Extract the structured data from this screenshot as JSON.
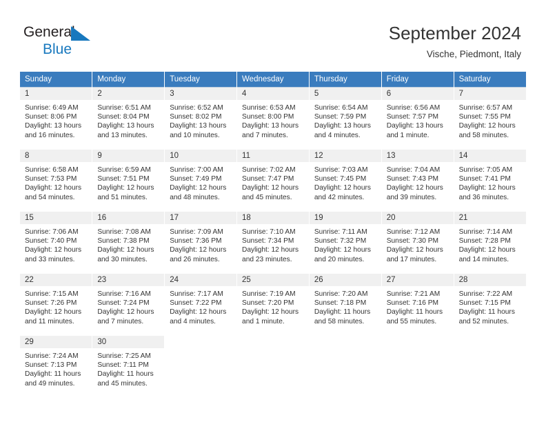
{
  "brand": {
    "name_part1": "General",
    "name_part2": "Blue",
    "flag_icon": "triangle-flag-icon",
    "color_dark": "#231f20",
    "color_blue": "#1878be"
  },
  "header": {
    "title": "September 2024",
    "location": "Vische, Piedmont, Italy"
  },
  "theme": {
    "header_bg": "#3a7cbe",
    "daynum_bg": "#f0f0f0",
    "row_divider": "#b9cbdd",
    "text": "#333333"
  },
  "weekday_headers": [
    "Sunday",
    "Monday",
    "Tuesday",
    "Wednesday",
    "Thursday",
    "Friday",
    "Saturday"
  ],
  "weeks": [
    [
      {
        "day": "1",
        "sunrise": "Sunrise: 6:49 AM",
        "sunset": "Sunset: 8:06 PM",
        "daylight1": "Daylight: 13 hours",
        "daylight2": "and 16 minutes."
      },
      {
        "day": "2",
        "sunrise": "Sunrise: 6:51 AM",
        "sunset": "Sunset: 8:04 PM",
        "daylight1": "Daylight: 13 hours",
        "daylight2": "and 13 minutes."
      },
      {
        "day": "3",
        "sunrise": "Sunrise: 6:52 AM",
        "sunset": "Sunset: 8:02 PM",
        "daylight1": "Daylight: 13 hours",
        "daylight2": "and 10 minutes."
      },
      {
        "day": "4",
        "sunrise": "Sunrise: 6:53 AM",
        "sunset": "Sunset: 8:00 PM",
        "daylight1": "Daylight: 13 hours",
        "daylight2": "and 7 minutes."
      },
      {
        "day": "5",
        "sunrise": "Sunrise: 6:54 AM",
        "sunset": "Sunset: 7:59 PM",
        "daylight1": "Daylight: 13 hours",
        "daylight2": "and 4 minutes."
      },
      {
        "day": "6",
        "sunrise": "Sunrise: 6:56 AM",
        "sunset": "Sunset: 7:57 PM",
        "daylight1": "Daylight: 13 hours",
        "daylight2": "and 1 minute."
      },
      {
        "day": "7",
        "sunrise": "Sunrise: 6:57 AM",
        "sunset": "Sunset: 7:55 PM",
        "daylight1": "Daylight: 12 hours",
        "daylight2": "and 58 minutes."
      }
    ],
    [
      {
        "day": "8",
        "sunrise": "Sunrise: 6:58 AM",
        "sunset": "Sunset: 7:53 PM",
        "daylight1": "Daylight: 12 hours",
        "daylight2": "and 54 minutes."
      },
      {
        "day": "9",
        "sunrise": "Sunrise: 6:59 AM",
        "sunset": "Sunset: 7:51 PM",
        "daylight1": "Daylight: 12 hours",
        "daylight2": "and 51 minutes."
      },
      {
        "day": "10",
        "sunrise": "Sunrise: 7:00 AM",
        "sunset": "Sunset: 7:49 PM",
        "daylight1": "Daylight: 12 hours",
        "daylight2": "and 48 minutes."
      },
      {
        "day": "11",
        "sunrise": "Sunrise: 7:02 AM",
        "sunset": "Sunset: 7:47 PM",
        "daylight1": "Daylight: 12 hours",
        "daylight2": "and 45 minutes."
      },
      {
        "day": "12",
        "sunrise": "Sunrise: 7:03 AM",
        "sunset": "Sunset: 7:45 PM",
        "daylight1": "Daylight: 12 hours",
        "daylight2": "and 42 minutes."
      },
      {
        "day": "13",
        "sunrise": "Sunrise: 7:04 AM",
        "sunset": "Sunset: 7:43 PM",
        "daylight1": "Daylight: 12 hours",
        "daylight2": "and 39 minutes."
      },
      {
        "day": "14",
        "sunrise": "Sunrise: 7:05 AM",
        "sunset": "Sunset: 7:41 PM",
        "daylight1": "Daylight: 12 hours",
        "daylight2": "and 36 minutes."
      }
    ],
    [
      {
        "day": "15",
        "sunrise": "Sunrise: 7:06 AM",
        "sunset": "Sunset: 7:40 PM",
        "daylight1": "Daylight: 12 hours",
        "daylight2": "and 33 minutes."
      },
      {
        "day": "16",
        "sunrise": "Sunrise: 7:08 AM",
        "sunset": "Sunset: 7:38 PM",
        "daylight1": "Daylight: 12 hours",
        "daylight2": "and 30 minutes."
      },
      {
        "day": "17",
        "sunrise": "Sunrise: 7:09 AM",
        "sunset": "Sunset: 7:36 PM",
        "daylight1": "Daylight: 12 hours",
        "daylight2": "and 26 minutes."
      },
      {
        "day": "18",
        "sunrise": "Sunrise: 7:10 AM",
        "sunset": "Sunset: 7:34 PM",
        "daylight1": "Daylight: 12 hours",
        "daylight2": "and 23 minutes."
      },
      {
        "day": "19",
        "sunrise": "Sunrise: 7:11 AM",
        "sunset": "Sunset: 7:32 PM",
        "daylight1": "Daylight: 12 hours",
        "daylight2": "and 20 minutes."
      },
      {
        "day": "20",
        "sunrise": "Sunrise: 7:12 AM",
        "sunset": "Sunset: 7:30 PM",
        "daylight1": "Daylight: 12 hours",
        "daylight2": "and 17 minutes."
      },
      {
        "day": "21",
        "sunrise": "Sunrise: 7:14 AM",
        "sunset": "Sunset: 7:28 PM",
        "daylight1": "Daylight: 12 hours",
        "daylight2": "and 14 minutes."
      }
    ],
    [
      {
        "day": "22",
        "sunrise": "Sunrise: 7:15 AM",
        "sunset": "Sunset: 7:26 PM",
        "daylight1": "Daylight: 12 hours",
        "daylight2": "and 11 minutes."
      },
      {
        "day": "23",
        "sunrise": "Sunrise: 7:16 AM",
        "sunset": "Sunset: 7:24 PM",
        "daylight1": "Daylight: 12 hours",
        "daylight2": "and 7 minutes."
      },
      {
        "day": "24",
        "sunrise": "Sunrise: 7:17 AM",
        "sunset": "Sunset: 7:22 PM",
        "daylight1": "Daylight: 12 hours",
        "daylight2": "and 4 minutes."
      },
      {
        "day": "25",
        "sunrise": "Sunrise: 7:19 AM",
        "sunset": "Sunset: 7:20 PM",
        "daylight1": "Daylight: 12 hours",
        "daylight2": "and 1 minute."
      },
      {
        "day": "26",
        "sunrise": "Sunrise: 7:20 AM",
        "sunset": "Sunset: 7:18 PM",
        "daylight1": "Daylight: 11 hours",
        "daylight2": "and 58 minutes."
      },
      {
        "day": "27",
        "sunrise": "Sunrise: 7:21 AM",
        "sunset": "Sunset: 7:16 PM",
        "daylight1": "Daylight: 11 hours",
        "daylight2": "and 55 minutes."
      },
      {
        "day": "28",
        "sunrise": "Sunrise: 7:22 AM",
        "sunset": "Sunset: 7:15 PM",
        "daylight1": "Daylight: 11 hours",
        "daylight2": "and 52 minutes."
      }
    ],
    [
      {
        "day": "29",
        "sunrise": "Sunrise: 7:24 AM",
        "sunset": "Sunset: 7:13 PM",
        "daylight1": "Daylight: 11 hours",
        "daylight2": "and 49 minutes."
      },
      {
        "day": "30",
        "sunrise": "Sunrise: 7:25 AM",
        "sunset": "Sunset: 7:11 PM",
        "daylight1": "Daylight: 11 hours",
        "daylight2": "and 45 minutes."
      },
      null,
      null,
      null,
      null,
      null
    ]
  ]
}
